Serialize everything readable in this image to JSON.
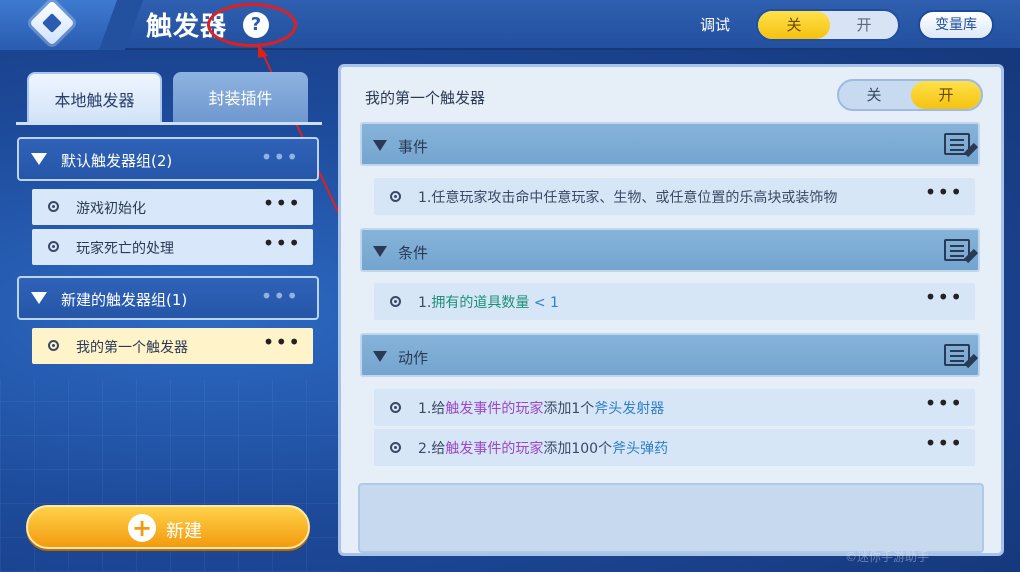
{
  "header": {
    "title": "触发器",
    "help_glyph": "?",
    "debug_label": "调试",
    "debug_off": "关",
    "debug_on": "开",
    "var_library": "变量库"
  },
  "left": {
    "tabs": [
      {
        "label": "本地触发器",
        "active": true
      },
      {
        "label": "封装插件",
        "active": false
      }
    ],
    "groups": [
      {
        "label": "默认触发器组(2)",
        "items": [
          "游戏初始化",
          "玩家死亡的处理"
        ]
      },
      {
        "label": "新建的触发器组(1)",
        "items": [
          "我的第一个触发器"
        ]
      }
    ],
    "selected_item": "我的第一个触发器",
    "more_glyph": "•••",
    "new_button": "新建",
    "new_glyph": "+"
  },
  "right": {
    "trigger_name": "我的第一个触发器",
    "toggle_off": "关",
    "toggle_on": "开",
    "sections": {
      "event": {
        "label": "事件",
        "rows": [
          {
            "prefix": "1.任意玩家攻击命中任意玩家、生物、或任意位置的乐高块或装饰物"
          }
        ]
      },
      "condition": {
        "label": "条件",
        "rows": [
          {
            "part1": "1.",
            "part2": "拥有的道具数量",
            "part3": "< 1"
          }
        ]
      },
      "action": {
        "label": "动作",
        "rows": [
          {
            "part1": "1.给",
            "part2": "触发事件的玩家",
            "part3": "添加1个",
            "part4": "斧头发射器"
          },
          {
            "part1": "2.给",
            "part2": "触发事件的玩家",
            "part3": "添加100个",
            "part4": "斧头弹药"
          }
        ]
      }
    }
  },
  "watermark": "©迷你手游助手",
  "colors": {
    "accent_yellow": "#f5c211",
    "header_blue": "#23509f",
    "annotation_red": "#e0201d",
    "text_green": "#1e8f7a",
    "text_purple": "#9b47c6",
    "text_blue": "#2f7fc9"
  }
}
